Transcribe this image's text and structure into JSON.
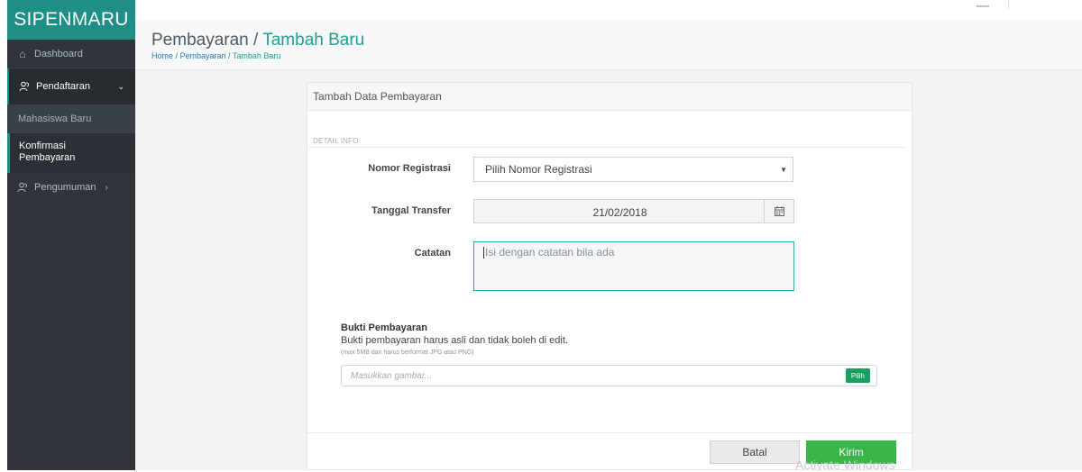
{
  "app": {
    "brand": "SIPENMARU"
  },
  "sidebar": {
    "items": [
      {
        "label": "Dashboard",
        "icon": "home-icon"
      },
      {
        "label": "Pendaftaran",
        "icon": "users-icon",
        "expanded": true,
        "children": [
          {
            "label": "Mahasiswa Baru"
          },
          {
            "label": "Konfirmasi Pembayaran",
            "active": true
          }
        ]
      },
      {
        "label": "Pengumuman",
        "icon": "users-icon"
      }
    ]
  },
  "header": {
    "title_main": "Pembayaran / ",
    "title_accent": "Tambah Baru",
    "breadcrumb": {
      "part1": "Home / Pembayaran / ",
      "last": "Tambah Baru"
    }
  },
  "panel": {
    "title": "Tambah Data Pembayaran",
    "section": "DETAIL INFO",
    "fields": {
      "nomor_label": "Nomor Registrasi",
      "nomor_value": "Pilih Nomor Registrasi",
      "tanggal_label": "Tanggal Transfer",
      "tanggal_value": "21/02/2018",
      "catatan_label": "Catatan",
      "catatan_placeholder": "Isi dengan catatan bila ada"
    },
    "bukti": {
      "title": "Bukti Pembayaran",
      "desc": "Bukti pembayaran harus asli dan tidak boleh di edit.",
      "hint": "(max 5MB dan harus berformat JPG atau PNG)",
      "placeholder": "Masukkan gambar...",
      "button": "Pilih"
    },
    "actions": {
      "batal": "Batal",
      "kirim": "Kirim"
    }
  },
  "watermark": "Activate Windows",
  "colors": {
    "accent": "#1e9e95",
    "sidebar": "#2f353b",
    "brand_bg": "#1e8e86",
    "primary_btn": "#39b54a"
  }
}
